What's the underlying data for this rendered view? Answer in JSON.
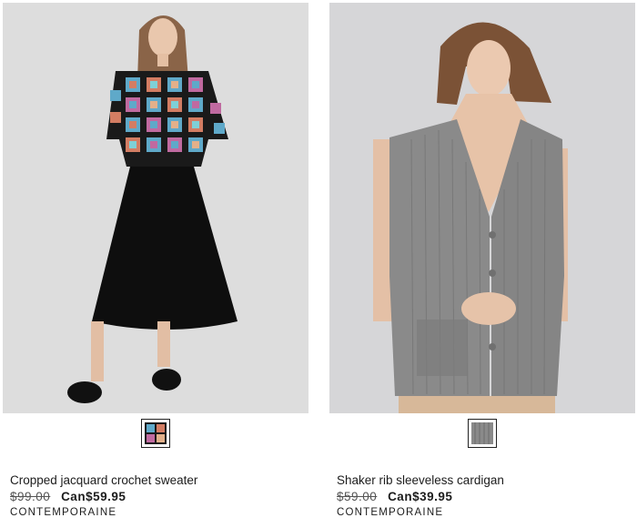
{
  "products": [
    {
      "title": "Cropped jacquard crochet sweater",
      "old_price": "$99.00",
      "new_price": "Can$59.95",
      "brand": "CONTEMPORAINE",
      "image_alt": "Woman wearing a cropped crochet granny-square sweater and black pleated midi skirt",
      "swatch_alt": "multicolor crochet pattern swatch"
    },
    {
      "title": "Shaker rib sleeveless cardigan",
      "old_price": "$59.00",
      "new_price": "Can$39.95",
      "brand": "CONTEMPORAINE",
      "image_alt": "Woman wearing a grey ribbed sleeveless cardigan",
      "swatch_alt": "grey heather swatch"
    }
  ],
  "colors": {
    "photo_bg": "#dcdcdd",
    "text": "#1c1c1c",
    "strike": "#555555",
    "cardigan_grey": "#8a8a8a"
  }
}
